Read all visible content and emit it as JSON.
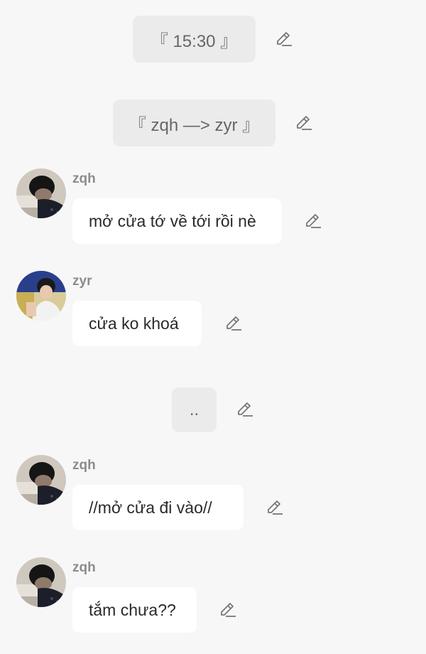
{
  "messages": [
    {
      "kind": "system",
      "text": "『 15:30 』"
    },
    {
      "kind": "system",
      "text": "『 zqh —> zyr 』"
    },
    {
      "kind": "chat",
      "sender": "zqh",
      "text": "mở cửa tớ về tới rồi nè"
    },
    {
      "kind": "chat",
      "sender": "zyr",
      "text": "cửa ko khoá"
    },
    {
      "kind": "system",
      "text": ".."
    },
    {
      "kind": "chat",
      "sender": "zqh",
      "text": "//mở cửa đi vào//"
    },
    {
      "kind": "chat",
      "sender": "zqh",
      "text": "tắm chưa??"
    }
  ],
  "icons": {
    "edit": "pencil-edit-icon",
    "avatar_zqh": "avatar-zqh",
    "avatar_zyr": "avatar-zyr"
  },
  "colors": {
    "background": "#f7f7f7",
    "system_bubble": "#ebebeb",
    "chat_bubble": "#ffffff",
    "sender_name": "#8c8c8c"
  }
}
